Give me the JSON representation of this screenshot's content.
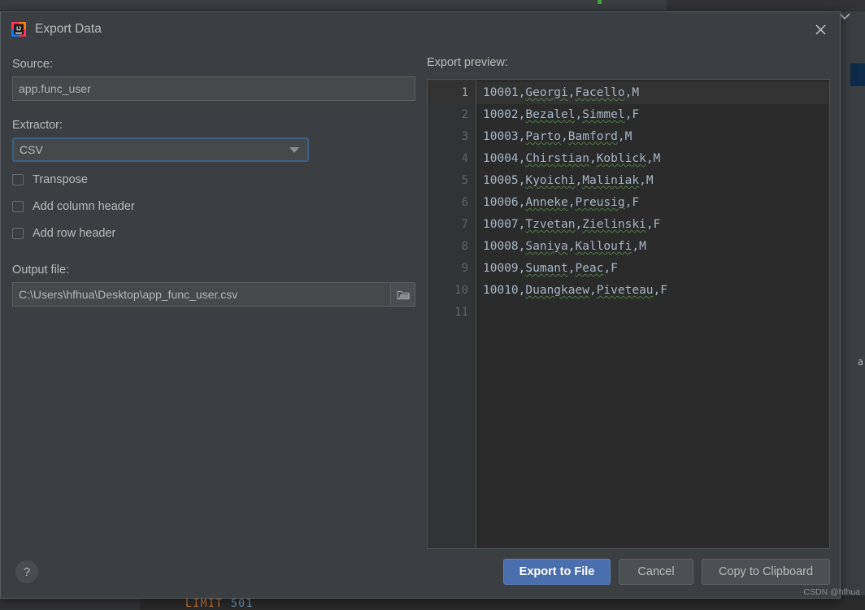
{
  "background": {
    "right_edge_letter": "a",
    "sql_fragment": {
      "keyword": "LIMIT",
      "number": "501"
    }
  },
  "dialog": {
    "title": "Export Data",
    "icon": "intellij-idea-icon",
    "close_icon": "close-icon",
    "source": {
      "label": "Source:",
      "value": "app.func_user",
      "placeholder": ""
    },
    "extractor": {
      "label": "Extractor:",
      "selected": "CSV",
      "arrow_icon": "chevron-down-icon"
    },
    "options": [
      {
        "label": "Transpose",
        "checked": false,
        "name": "transpose"
      },
      {
        "label": "Add column header",
        "checked": false,
        "name": "add-column-header"
      },
      {
        "label": "Add row header",
        "checked": false,
        "name": "add-row-header"
      }
    ],
    "output": {
      "label": "Output file:",
      "value": "C:\\Users\\hfhua\\Desktop\\app_func_user.csv",
      "placeholder": "",
      "browse_icon": "folder-icon"
    },
    "preview": {
      "label": "Export preview:",
      "line_numbers": [
        "1",
        "2",
        "3",
        "4",
        "5",
        "6",
        "7",
        "8",
        "9",
        "10",
        "11"
      ],
      "lines": [
        "10001,Georgi,Facello,M",
        "10002,Bezalel,Simmel,F",
        "10003,Parto,Bamford,M",
        "10004,Chirstian,Koblick,M",
        "10005,Kyoichi,Maliniak,M",
        "10006,Anneke,Preusig,F",
        "10007,Tzvetan,Zielinski,F",
        "10008,Saniya,Kalloufi,M",
        "10009,Sumant,Peac,F",
        "10010,Duangkaew,Piveteau,F",
        ""
      ],
      "rows": [
        {
          "id": "10001",
          "first_name": "Georgi",
          "last_name": "Facello",
          "gender": "M"
        },
        {
          "id": "10002",
          "first_name": "Bezalel",
          "last_name": "Simmel",
          "gender": "F"
        },
        {
          "id": "10003",
          "first_name": "Parto",
          "last_name": "Bamford",
          "gender": "M"
        },
        {
          "id": "10004",
          "first_name": "Chirstian",
          "last_name": "Koblick",
          "gender": "M"
        },
        {
          "id": "10005",
          "first_name": "Kyoichi",
          "last_name": "Maliniak",
          "gender": "M"
        },
        {
          "id": "10006",
          "first_name": "Anneke",
          "last_name": "Preusig",
          "gender": "F"
        },
        {
          "id": "10007",
          "first_name": "Tzvetan",
          "last_name": "Zielinski",
          "gender": "F"
        },
        {
          "id": "10008",
          "first_name": "Saniya",
          "last_name": "Kalloufi",
          "gender": "M"
        },
        {
          "id": "10009",
          "first_name": "Sumant",
          "last_name": "Peac",
          "gender": "F"
        },
        {
          "id": "10010",
          "first_name": "Duangkaew",
          "last_name": "Piveteau",
          "gender": "F"
        }
      ]
    },
    "footer": {
      "help_label": "?",
      "export_label": "Export to File",
      "cancel_label": "Cancel",
      "copy_label": "Copy to Clipboard"
    }
  },
  "watermark": "CSDN @hfhua",
  "colors": {
    "dialog_bg": "#3c3f41",
    "field_bg": "#45494a",
    "editor_bg": "#2b2b2b",
    "gutter_bg": "#313335",
    "accent_blue": "#4b6eaf",
    "focus_border": "#3d6185",
    "code_text": "#a9b7c6",
    "spellcheck_underline": "#4f7a4a",
    "sql_keyword": "#cc7832",
    "sql_number": "#6897bb"
  }
}
